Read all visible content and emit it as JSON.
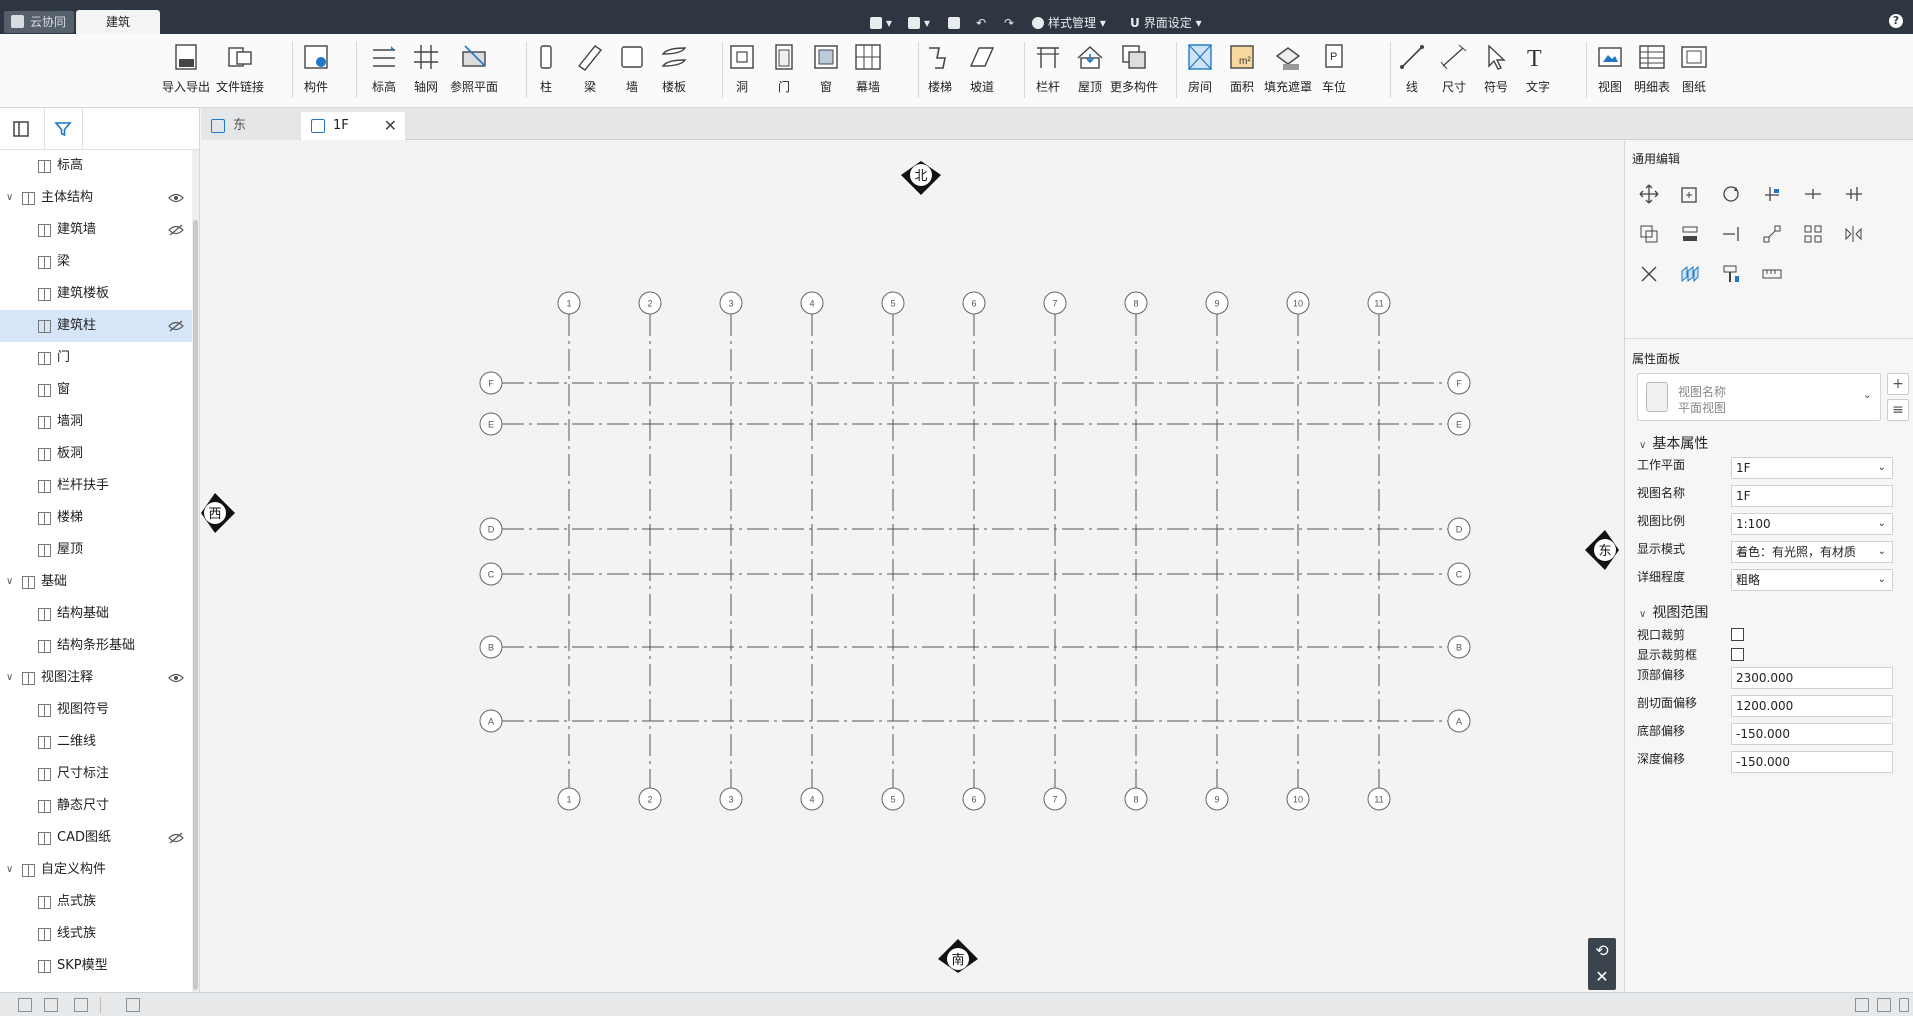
{
  "titlebar": {
    "tabs": [
      {
        "label": "云协同"
      },
      {
        "label": "建筑"
      }
    ],
    "quick_actions": {
      "style_manage": "样式管理",
      "ui_settings": "界面设定"
    },
    "help": "?"
  },
  "ribbon": {
    "buttons": [
      {
        "label": "导入导出",
        "icon": "cad-import-icon"
      },
      {
        "label": "文件链接",
        "icon": "file-link-icon"
      },
      {
        "label": "构件",
        "icon": "component-icon"
      },
      {
        "label": "标高",
        "icon": "level-icon"
      },
      {
        "label": "轴网",
        "icon": "grid-icon"
      },
      {
        "label": "参照平面",
        "icon": "reference-plane-icon"
      },
      {
        "label": "柱",
        "icon": "column-icon"
      },
      {
        "label": "梁",
        "icon": "beam-icon"
      },
      {
        "label": "墙",
        "icon": "wall-icon"
      },
      {
        "label": "楼板",
        "icon": "slab-icon"
      },
      {
        "label": "洞",
        "icon": "opening-icon"
      },
      {
        "label": "门",
        "icon": "door-icon"
      },
      {
        "label": "窗",
        "icon": "window-icon"
      },
      {
        "label": "幕墙",
        "icon": "curtain-wall-icon"
      },
      {
        "label": "楼梯",
        "icon": "stair-icon"
      },
      {
        "label": "坡道",
        "icon": "ramp-icon"
      },
      {
        "label": "栏杆",
        "icon": "railing-icon"
      },
      {
        "label": "屋顶",
        "icon": "roof-icon"
      },
      {
        "label": "更多构件",
        "icon": "more-components-icon"
      },
      {
        "label": "房间",
        "icon": "room-icon"
      },
      {
        "label": "面积",
        "icon": "area-icon"
      },
      {
        "label": "填充遮罩",
        "icon": "fill-mask-icon"
      },
      {
        "label": "车位",
        "icon": "parking-icon"
      },
      {
        "label": "线",
        "icon": "line-icon"
      },
      {
        "label": "尺寸",
        "icon": "dimension-icon"
      },
      {
        "label": "符号",
        "icon": "symbol-icon"
      },
      {
        "label": "文字",
        "icon": "text-icon"
      },
      {
        "label": "视图",
        "icon": "view-icon"
      },
      {
        "label": "明细表",
        "icon": "schedule-icon"
      },
      {
        "label": "图纸",
        "icon": "sheet-icon"
      }
    ]
  },
  "tree": {
    "items": [
      {
        "label": "标高",
        "level": 1
      },
      {
        "label": "主体结构",
        "level": 0,
        "eye": "visible"
      },
      {
        "label": "建筑墙",
        "level": 1,
        "eye": "hidden"
      },
      {
        "label": "梁",
        "level": 1
      },
      {
        "label": "建筑楼板",
        "level": 1
      },
      {
        "label": "建筑柱",
        "level": 1,
        "eye": "hidden",
        "selected": true
      },
      {
        "label": "门",
        "level": 1
      },
      {
        "label": "窗",
        "level": 1
      },
      {
        "label": "墙洞",
        "level": 1
      },
      {
        "label": "板洞",
        "level": 1
      },
      {
        "label": "栏杆扶手",
        "level": 1
      },
      {
        "label": "楼梯",
        "level": 1
      },
      {
        "label": "屋顶",
        "level": 1
      },
      {
        "label": "基础",
        "level": 0
      },
      {
        "label": "结构基础",
        "level": 1
      },
      {
        "label": "结构条形基础",
        "level": 1
      },
      {
        "label": "视图注释",
        "level": 0,
        "eye": "visible"
      },
      {
        "label": "视图符号",
        "level": 1
      },
      {
        "label": "二维线",
        "level": 1
      },
      {
        "label": "尺寸标注",
        "level": 1
      },
      {
        "label": "静态尺寸",
        "level": 1
      },
      {
        "label": "CAD图纸",
        "level": 1,
        "eye": "hidden"
      },
      {
        "label": "自定义构件",
        "level": 0
      },
      {
        "label": "点式族",
        "level": 1
      },
      {
        "label": "线式族",
        "level": 1
      },
      {
        "label": "SKP模型",
        "level": 1
      }
    ]
  },
  "doc_tabs": [
    {
      "label": "东"
    },
    {
      "label": "1F"
    }
  ],
  "canvas": {
    "compass": {
      "north": "北",
      "south": "南",
      "west": "西",
      "east": "东"
    },
    "vertical_grid_labels": [
      "1",
      "2",
      "3",
      "4",
      "5",
      "6",
      "7",
      "8",
      "9",
      "10",
      "11"
    ],
    "horizontal_grid_labels": [
      "F",
      "E",
      "D",
      "C",
      "B",
      "A"
    ]
  },
  "right_panel": {
    "general_edit_title": "通用编辑",
    "property_panel_title": "属性面板",
    "view_card": {
      "line1": "视图名称",
      "line2": "平面视图"
    },
    "basic_props_title": "基本属性",
    "basic_props": [
      {
        "label": "工作平面",
        "value": "1F",
        "type": "select"
      },
      {
        "label": "视图名称",
        "value": "1F",
        "type": "input"
      },
      {
        "label": "视图比例",
        "value": "1:100",
        "type": "select"
      },
      {
        "label": "显示模式",
        "value": "着色：有光照，有材质",
        "type": "select"
      },
      {
        "label": "详细程度",
        "value": "粗略",
        "type": "select"
      }
    ],
    "view_range_title": "视图范围",
    "view_range": [
      {
        "label": "视口裁剪",
        "type": "checkbox",
        "checked": false
      },
      {
        "label": "显示裁剪框",
        "type": "checkbox",
        "checked": false
      },
      {
        "label": "顶部偏移",
        "value": "2300.000",
        "type": "input"
      },
      {
        "label": "剖切面偏移",
        "value": "1200.000",
        "type": "input"
      },
      {
        "label": "底部偏移",
        "value": "-150.000",
        "type": "input"
      },
      {
        "label": "深度偏移",
        "value": "-150.000",
        "type": "input"
      }
    ]
  }
}
